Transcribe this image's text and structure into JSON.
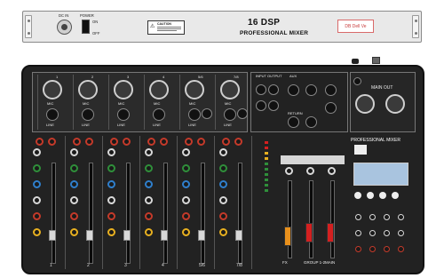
{
  "rack": {
    "dc_in_label": "DC IN",
    "power_label": "POWER",
    "on_label": "ON",
    "off_label": "OFF",
    "warning_title": "CAUTION",
    "model": "16 DSP",
    "subtitle": "PROFESSIONAL MIXER",
    "red_box_text": "DB  Dell Ve"
  },
  "top_panel": {
    "channels": [
      "1",
      "2",
      "3",
      "4",
      "5/6",
      "7/8"
    ],
    "mic_label": "MIC",
    "line_label": "LINE",
    "input_output_label": "INPUT  OUTPUT",
    "aux_label": "AUX",
    "return_label": "RETURN",
    "main_out_label": "MAIN OUT"
  },
  "surface": {
    "channel_labels": [
      "1",
      "2",
      "3",
      "4",
      "5/6",
      "7/8"
    ],
    "brand_title": "PROFESSIONAL MIXER",
    "master_labels": [
      "FX",
      "GROUP 1-2",
      "MAIN"
    ],
    "knob_colors": [
      "#c43a2a",
      "#d8d8d8",
      "#2f8f3a",
      "#2f7fcc",
      "#d8d8d8",
      "#c43a2a",
      "#e8b020"
    ],
    "display_color": "#a9c4df",
    "fader_cap_colors": {
      "fx": "#e8901c",
      "group": "#d42020",
      "main": "#d42020"
    }
  }
}
